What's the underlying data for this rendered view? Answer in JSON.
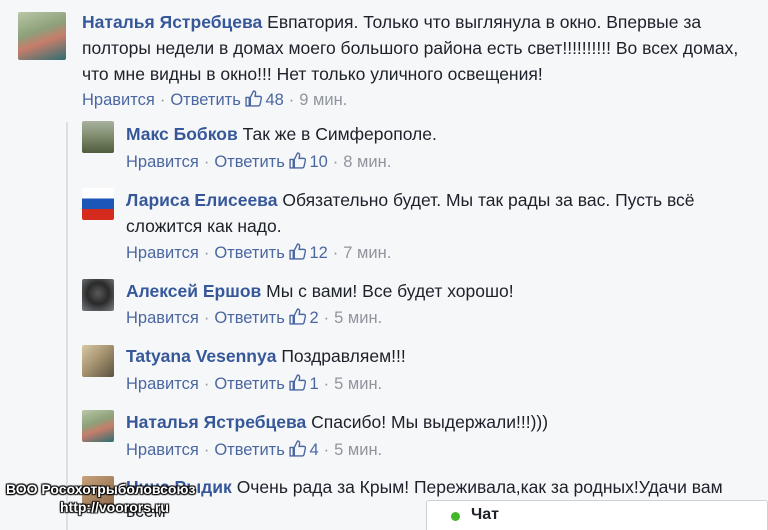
{
  "main_comment": {
    "author": "Наталья Ястребцева",
    "text": "Евпатория. Только что выглянула в окно. Впервые за полторы недели в домах моего большого района есть свет!!!!!!!!!! Во всех домах, что мне видны в окно!!! Нет только уличного освещения!",
    "like_label": "Нравится",
    "reply_label": "Ответить",
    "likes": "48",
    "time": "9 мин."
  },
  "replies": [
    {
      "author": "Макс Бобков",
      "text": "Так же в Симферополе.",
      "like_label": "Нравится",
      "reply_label": "Ответить",
      "likes": "10",
      "time": "8 мин."
    },
    {
      "author": "Лариса Елисеева",
      "text": "Обязательно будет. Мы так рады за вас. Пусть всё сложится как надо.",
      "like_label": "Нравится",
      "reply_label": "Ответить",
      "likes": "12",
      "time": "7 мин."
    },
    {
      "author": "Алексей Ершов",
      "text": "Мы с вами! Все будет хорошо!",
      "like_label": "Нравится",
      "reply_label": "Ответить",
      "likes": "2",
      "time": "5 мин."
    },
    {
      "author": "Tatyana Vesennya",
      "text": "Поздравляем!!!",
      "like_label": "Нравится",
      "reply_label": "Ответить",
      "likes": "1",
      "time": "5 мин."
    },
    {
      "author": "Наталья Ястребцева",
      "text": "Спасибо! Мы выдержали!!!)))",
      "like_label": "Нравится",
      "reply_label": "Ответить",
      "likes": "4",
      "time": "5 мин."
    },
    {
      "author": "Нина Рыдик",
      "text": "Очень рада за Крым! Переживала,как за родных!Удачи вам всем"
    }
  ],
  "watermark": {
    "line1": "ВОО Росохотрыболовсоюз",
    "line2": "http://voorors.ru"
  },
  "chat": {
    "label": "Чат",
    "status_color": "#42b72a"
  },
  "colors": {
    "author": "#365899",
    "link": "#4b67a1",
    "meta": "#90949c",
    "background": "#f6f7f9"
  }
}
